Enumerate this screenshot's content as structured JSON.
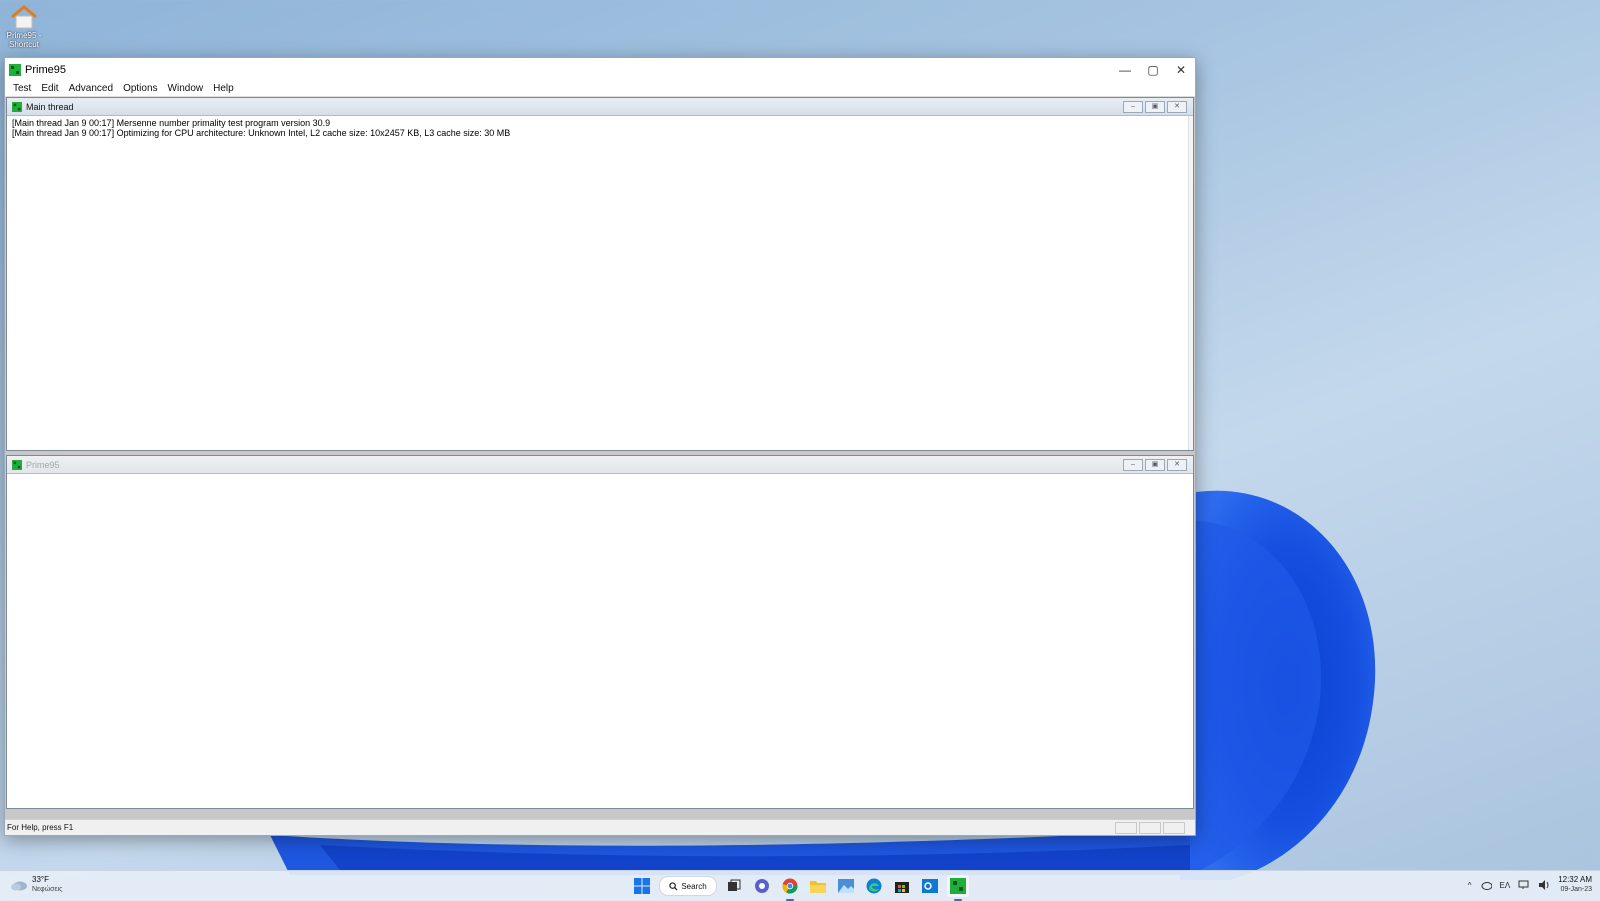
{
  "desktop": {
    "icon_label": "Prime95 - Shortcut"
  },
  "window": {
    "title": "Prime95",
    "controls": {
      "minimize": "—",
      "maximize": "▢",
      "close": "✕"
    }
  },
  "menu": {
    "items": [
      "Test",
      "Edit",
      "Advanced",
      "Options",
      "Window",
      "Help"
    ]
  },
  "main_thread": {
    "title": "Main thread",
    "lines": [
      "[Main thread Jan 9 00:17] Mersenne number primality test program version 30.9",
      "[Main thread Jan 9 00:17] Optimizing for CPU architecture: Unknown Intel, L2 cache size: 10x2457 KB, L3 cache size: 30 MB"
    ]
  },
  "second_child": {
    "title": "Prime95"
  },
  "child_controls": {
    "minimize": "–",
    "restore": "▣",
    "close": "✕"
  },
  "statusbar": {
    "text": "For Help, press F1"
  },
  "taskbar": {
    "weather_temp": "33°F",
    "weather_desc": "Νεφώσεις",
    "search_label": "Search",
    "language": "ΕΛ",
    "time": "12:32 AM",
    "date": "09-Jan-23"
  },
  "colors": {
    "prime95_green": "#1fae3a",
    "accent": "#2b6fd6"
  }
}
